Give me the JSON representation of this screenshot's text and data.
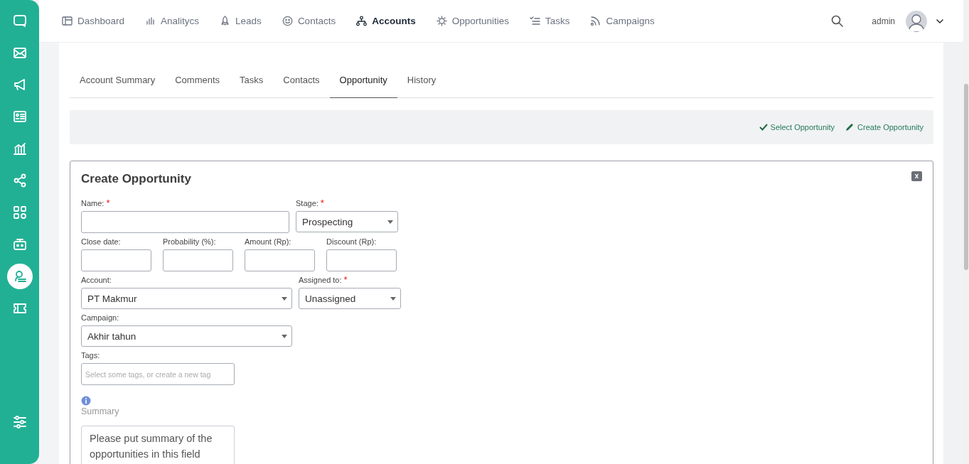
{
  "sidebar": {
    "items": [
      {
        "selected": false
      },
      {
        "selected": false
      },
      {
        "selected": false
      },
      {
        "selected": false
      },
      {
        "selected": false
      },
      {
        "selected": false
      },
      {
        "selected": false
      },
      {
        "selected": false
      },
      {
        "selected": true
      },
      {
        "selected": false
      }
    ]
  },
  "nav": {
    "items": [
      {
        "label": "Dashboard",
        "selected": false
      },
      {
        "label": "Analitycs",
        "selected": false
      },
      {
        "label": "Leads",
        "selected": false
      },
      {
        "label": "Contacts",
        "selected": false
      },
      {
        "label": "Accounts",
        "selected": true
      },
      {
        "label": "Opportunities",
        "selected": false
      },
      {
        "label": "Tasks",
        "selected": false
      },
      {
        "label": "Campaigns",
        "selected": false
      }
    ],
    "user": "admin"
  },
  "tabs": [
    {
      "label": "Account Summary",
      "selected": false
    },
    {
      "label": "Comments",
      "selected": false
    },
    {
      "label": "Tasks",
      "selected": false
    },
    {
      "label": "Contacts",
      "selected": false
    },
    {
      "label": "Opportunity",
      "selected": true
    },
    {
      "label": "History",
      "selected": false
    }
  ],
  "actions": [
    {
      "kind": "select",
      "label": "Select Opportunity"
    },
    {
      "kind": "create",
      "label": "Create Opportunity"
    }
  ],
  "form": {
    "title": "Create Opportunity",
    "close_label": "x",
    "rows": [
      [
        {
          "kind": "text",
          "label": "Name:",
          "required_mark": "*"
        },
        {
          "kind": "select",
          "label": "Stage:",
          "required_mark": "*",
          "value": "Prospecting"
        }
      ],
      [
        {
          "kind": "text",
          "label": "Close date:"
        },
        {
          "kind": "text",
          "label": "Probability (%):"
        },
        {
          "kind": "text",
          "label": "Amount (Rp):"
        },
        {
          "kind": "text",
          "label": "Discount (Rp):"
        }
      ],
      [
        {
          "kind": "select",
          "label": "Account:",
          "value": "PT Makmur"
        },
        {
          "kind": "select",
          "label": "Assigned to:",
          "required_mark": "*",
          "value": "Unassigned"
        }
      ],
      [
        {
          "kind": "select",
          "label": "Campaign:",
          "value": "Akhir tahun"
        }
      ],
      [
        {
          "kind": "tags",
          "label": "Tags:",
          "placeholder": "Select some tags, or create a new tag"
        }
      ]
    ],
    "summary": {
      "label": "Summary",
      "placeholder": "Please put summary of the opportunities in this field"
    }
  }
}
